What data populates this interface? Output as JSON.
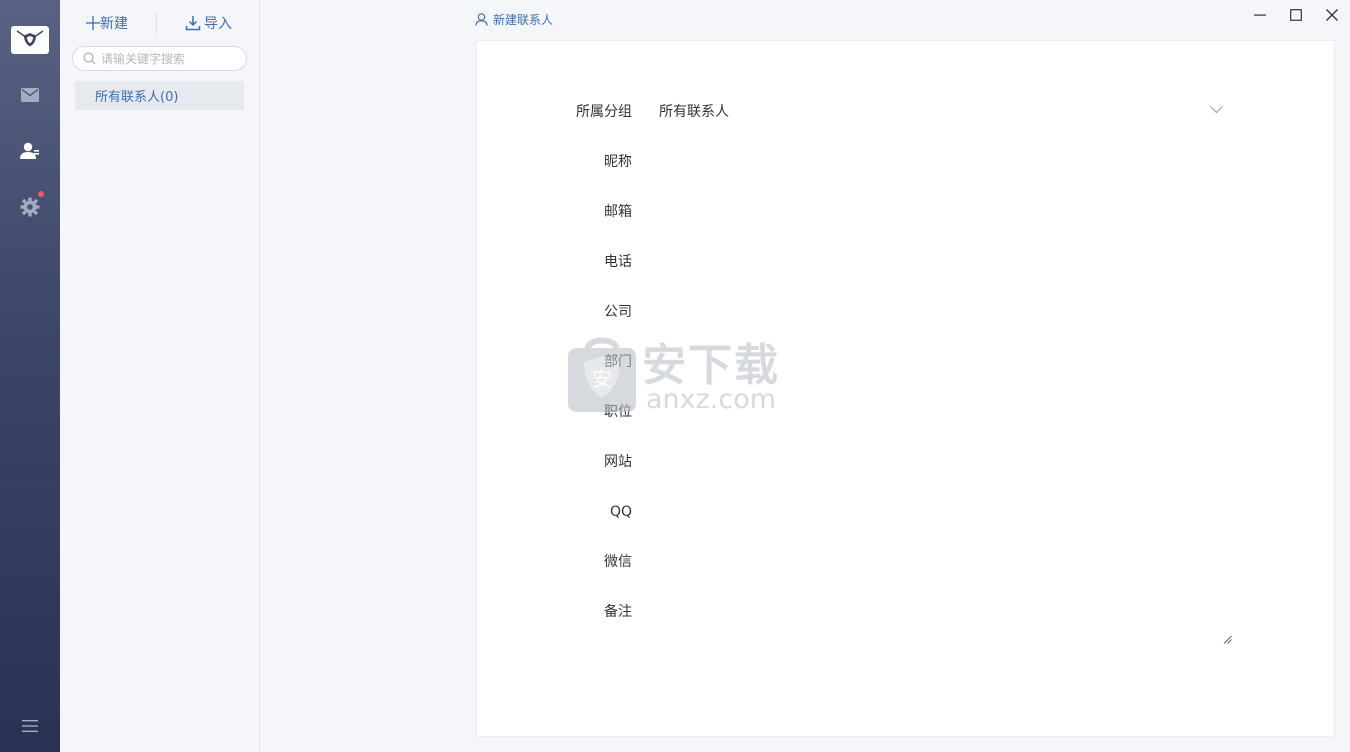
{
  "rail": {
    "icons": [
      "mail-shield-logo",
      "mail-icon",
      "contacts-icon",
      "settings-icon",
      "menu-icon"
    ],
    "badge_color": "#f0565a"
  },
  "toolbar": {
    "new_label": "新建",
    "import_label": "导入"
  },
  "search": {
    "placeholder": "请输关键字搜索"
  },
  "groups": {
    "all_label": "所有联系人(0)"
  },
  "header": {
    "title": "新建联系人"
  },
  "form": {
    "group": {
      "label": "所属分组",
      "value": "所有联系人"
    },
    "nickname": {
      "label": "昵称",
      "value": ""
    },
    "email": {
      "label": "邮箱",
      "value": ""
    },
    "phone": {
      "label": "电话",
      "value": ""
    },
    "company": {
      "label": "公司",
      "value": ""
    },
    "department": {
      "label": "部门",
      "value": ""
    },
    "position": {
      "label": "职位",
      "value": ""
    },
    "website": {
      "label": "网站",
      "value": ""
    },
    "qq": {
      "label": "QQ",
      "value": ""
    },
    "wechat": {
      "label": "微信",
      "value": ""
    },
    "note": {
      "label": "备注",
      "value": ""
    }
  },
  "watermark": {
    "text_main": "安下载",
    "text_sub": "anxz.com",
    "shield_char": "安"
  },
  "colors": {
    "accent": "#3b6fb6",
    "rail_top": "#5a6283",
    "rail_bottom": "#2b3152"
  }
}
